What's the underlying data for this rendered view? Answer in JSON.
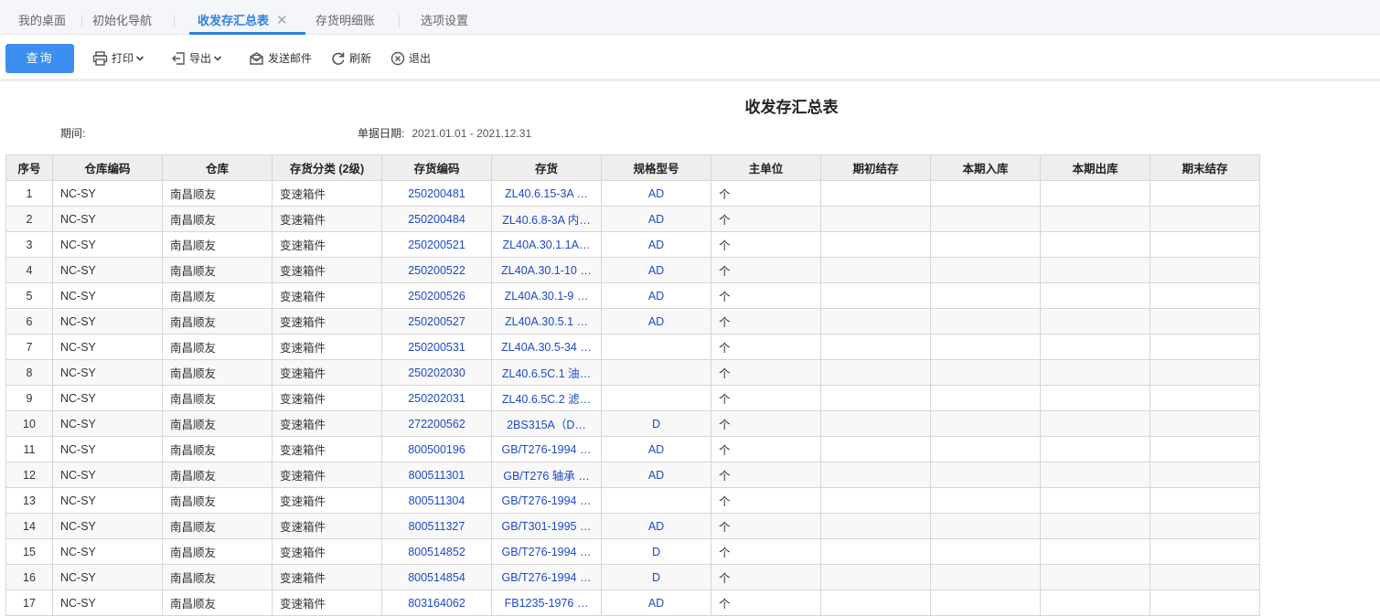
{
  "tabs": [
    {
      "label": "我的桌面"
    },
    {
      "label": "初始化导航"
    },
    {
      "label": "收发存汇总表",
      "close": "✕"
    },
    {
      "label": "存货明细账"
    },
    {
      "label": "选项设置"
    }
  ],
  "toolbar": {
    "query": "查询",
    "print": "打印",
    "export": "导出",
    "email": "发送邮件",
    "refresh": "刷新",
    "exit": "退出"
  },
  "report": {
    "title": "收发存汇总表",
    "period_label": "期间:",
    "period_value": "",
    "date_label": "单据日期:",
    "date_value": "2021.01.01 - 2021.12.31"
  },
  "table": {
    "headers": [
      "序号",
      "仓库编码",
      "仓库",
      "存货分类 (2级)",
      "存货编码",
      "存货",
      "规格型号",
      "主单位",
      "期初结存",
      "本期入库",
      "本期出库",
      "期末结存"
    ],
    "rows": [
      [
        "1",
        "NC-SY",
        "南昌顺友",
        "变速箱件",
        "250200481",
        "ZL40.6.15-3A …",
        "AD",
        "个",
        "",
        "",
        "",
        ""
      ],
      [
        "2",
        "NC-SY",
        "南昌顺友",
        "变速箱件",
        "250200484",
        "ZL40.6.8-3A 内…",
        "AD",
        "个",
        "",
        "",
        "",
        ""
      ],
      [
        "3",
        "NC-SY",
        "南昌顺友",
        "变速箱件",
        "250200521",
        "ZL40A.30.1.1A…",
        "AD",
        "个",
        "",
        "",
        "",
        ""
      ],
      [
        "4",
        "NC-SY",
        "南昌顺友",
        "变速箱件",
        "250200522",
        "ZL40A.30.1-10 …",
        "AD",
        "个",
        "",
        "",
        "",
        ""
      ],
      [
        "5",
        "NC-SY",
        "南昌顺友",
        "变速箱件",
        "250200526",
        "ZL40A.30.1-9 …",
        "AD",
        "个",
        "",
        "",
        "",
        ""
      ],
      [
        "6",
        "NC-SY",
        "南昌顺友",
        "变速箱件",
        "250200527",
        "ZL40A.30.5.1 …",
        "AD",
        "个",
        "",
        "",
        "",
        ""
      ],
      [
        "7",
        "NC-SY",
        "南昌顺友",
        "变速箱件",
        "250200531",
        "ZL40A.30.5-34 …",
        "",
        "个",
        "",
        "",
        "",
        ""
      ],
      [
        "8",
        "NC-SY",
        "南昌顺友",
        "变速箱件",
        "250202030",
        "ZL40.6.5C.1 油…",
        "",
        "个",
        "",
        "",
        "",
        ""
      ],
      [
        "9",
        "NC-SY",
        "南昌顺友",
        "变速箱件",
        "250202031",
        "ZL40.6.5C.2 滤…",
        "",
        "个",
        "",
        "",
        "",
        ""
      ],
      [
        "10",
        "NC-SY",
        "南昌顺友",
        "变速箱件",
        "272200562",
        "2BS315A（D…",
        "D",
        "个",
        "",
        "",
        "",
        ""
      ],
      [
        "11",
        "NC-SY",
        "南昌顺友",
        "变速箱件",
        "800500196",
        "GB/T276-1994 …",
        "AD",
        "个",
        "",
        "",
        "",
        ""
      ],
      [
        "12",
        "NC-SY",
        "南昌顺友",
        "变速箱件",
        "800511301",
        "GB/T276 轴承 …",
        "AD",
        "个",
        "",
        "",
        "",
        ""
      ],
      [
        "13",
        "NC-SY",
        "南昌顺友",
        "变速箱件",
        "800511304",
        "GB/T276-1994 …",
        "",
        "个",
        "",
        "",
        "",
        ""
      ],
      [
        "14",
        "NC-SY",
        "南昌顺友",
        "变速箱件",
        "800511327",
        "GB/T301-1995 …",
        "AD",
        "个",
        "",
        "",
        "",
        ""
      ],
      [
        "15",
        "NC-SY",
        "南昌顺友",
        "变速箱件",
        "800514852",
        "GB/T276-1994 …",
        "D",
        "个",
        "",
        "",
        "",
        ""
      ],
      [
        "16",
        "NC-SY",
        "南昌顺友",
        "变速箱件",
        "800514854",
        "GB/T276-1994 …",
        "D",
        "个",
        "",
        "",
        "",
        ""
      ],
      [
        "17",
        "NC-SY",
        "南昌顺友",
        "变速箱件",
        "803164062",
        "FB1235-1976 …",
        "AD",
        "个",
        "",
        "",
        "",
        ""
      ]
    ]
  },
  "colors": {
    "accent": "#2f7fe6",
    "primary_button": "#3c8ef1",
    "link": "#1f48c9"
  }
}
